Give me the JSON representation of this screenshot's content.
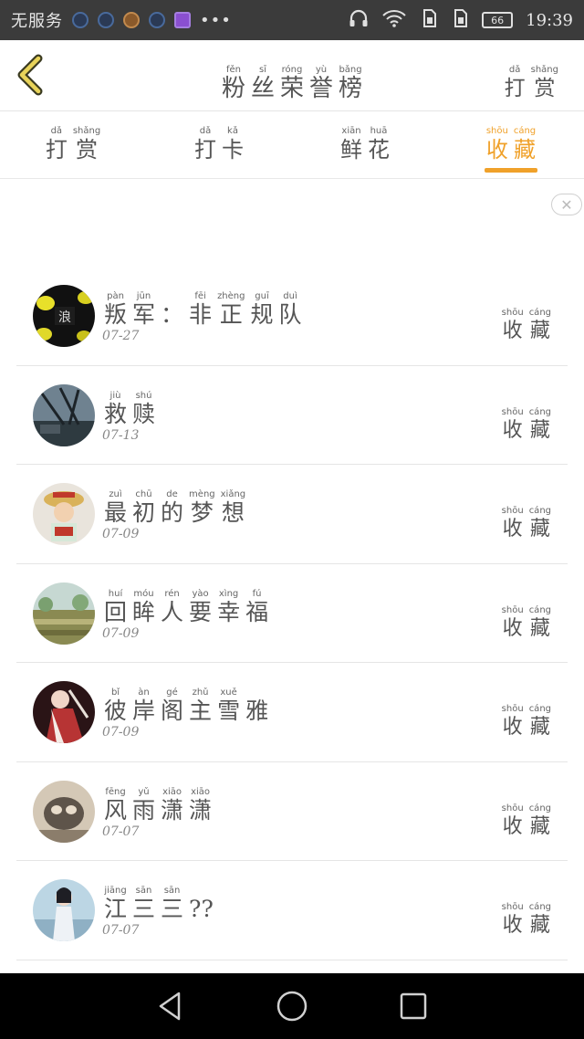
{
  "status_bar": {
    "carrier": "无服务",
    "time": "19:39",
    "battery": "66",
    "icons": [
      "app-icon",
      "app-icon",
      "food-icon",
      "app-icon",
      "image-icon",
      "more-icon",
      "headphones-icon",
      "wifi-icon",
      "sim-icon",
      "sim-icon",
      "battery-icon"
    ]
  },
  "header": {
    "title": [
      {
        "py": "fěn",
        "ch": "粉"
      },
      {
        "py": "sī",
        "ch": "丝"
      },
      {
        "py": "róng",
        "ch": "荣"
      },
      {
        "py": "yù",
        "ch": "誉"
      },
      {
        "py": "bǎng",
        "ch": "榜"
      }
    ],
    "action": [
      {
        "py": "dǎ",
        "ch": "打"
      },
      {
        "py": "shǎng",
        "ch": "赏"
      }
    ]
  },
  "tabs": [
    {
      "chars": [
        {
          "py": "dǎ",
          "ch": "打"
        },
        {
          "py": "shǎng",
          "ch": "赏"
        }
      ],
      "active": false
    },
    {
      "chars": [
        {
          "py": "dǎ",
          "ch": "打"
        },
        {
          "py": "kǎ",
          "ch": "卡"
        }
      ],
      "active": false
    },
    {
      "chars": [
        {
          "py": "xiān",
          "ch": "鲜"
        },
        {
          "py": "huā",
          "ch": "花"
        }
      ],
      "active": false
    },
    {
      "chars": [
        {
          "py": "shōu",
          "ch": "收"
        },
        {
          "py": "cáng",
          "ch": "藏"
        }
      ],
      "active": true
    }
  ],
  "row_action": [
    {
      "py": "shōu",
      "ch": "收"
    },
    {
      "py": "cáng",
      "ch": "藏"
    }
  ],
  "colors": {
    "accent": "#f0a12a",
    "status_bar": "#3b3b3b",
    "nav_bar": "#000000"
  },
  "list": [
    {
      "name": [
        {
          "py": "pàn",
          "ch": "叛"
        },
        {
          "py": "jūn",
          "ch": "军"
        },
        {
          "py": "",
          "ch": "："
        },
        {
          "py": "fēi",
          "ch": "非"
        },
        {
          "py": "zhèng",
          "ch": "正"
        },
        {
          "py": "guī",
          "ch": "规"
        },
        {
          "py": "duì",
          "ch": "队"
        }
      ],
      "date": "07-27"
    },
    {
      "name": [
        {
          "py": "jiù",
          "ch": "救"
        },
        {
          "py": "shú",
          "ch": "赎"
        }
      ],
      "date": "07-13"
    },
    {
      "name": [
        {
          "py": "zuì",
          "ch": "最"
        },
        {
          "py": "chū",
          "ch": "初"
        },
        {
          "py": "de",
          "ch": "的"
        },
        {
          "py": "mèng",
          "ch": "梦"
        },
        {
          "py": "xiǎng",
          "ch": "想"
        }
      ],
      "date": "07-09"
    },
    {
      "name": [
        {
          "py": "huí",
          "ch": "回"
        },
        {
          "py": "móu",
          "ch": "眸"
        },
        {
          "py": "rén",
          "ch": "人"
        },
        {
          "py": "yào",
          "ch": "要"
        },
        {
          "py": "xìng",
          "ch": "幸"
        },
        {
          "py": "fú",
          "ch": "福"
        }
      ],
      "date": "07-09"
    },
    {
      "name": [
        {
          "py": "bǐ",
          "ch": "彼"
        },
        {
          "py": "àn",
          "ch": "岸"
        },
        {
          "py": "gé",
          "ch": "阁"
        },
        {
          "py": "zhǔ",
          "ch": "主"
        },
        {
          "py": "xuě",
          "ch": "雪"
        },
        {
          "py": "",
          "ch": "雅"
        }
      ],
      "date": "07-09"
    },
    {
      "name": [
        {
          "py": "fēng",
          "ch": "风"
        },
        {
          "py": "yǔ",
          "ch": "雨"
        },
        {
          "py": "xiāo",
          "ch": "潇"
        },
        {
          "py": "xiāo",
          "ch": "潇"
        }
      ],
      "date": "07-07"
    },
    {
      "name": [
        {
          "py": "jiāng",
          "ch": "江"
        },
        {
          "py": "sān",
          "ch": "三"
        },
        {
          "py": "sān",
          "ch": "三"
        },
        {
          "py": "",
          "ch": "??"
        }
      ],
      "date": "07-07"
    }
  ]
}
